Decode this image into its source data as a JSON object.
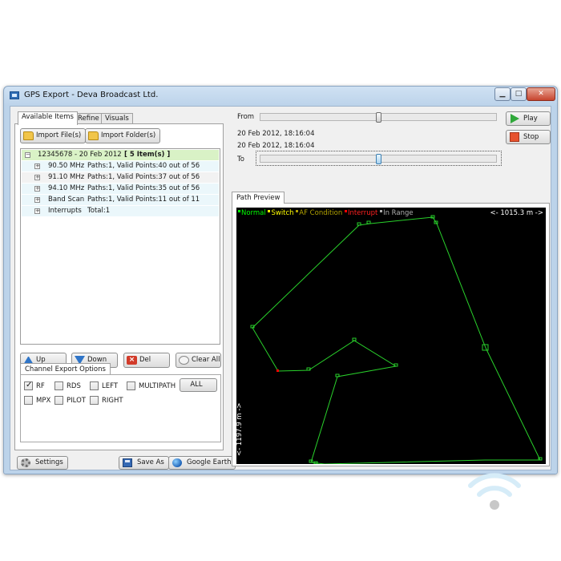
{
  "window": {
    "title": "GPS Export - Deva Broadcast Ltd."
  },
  "colors": {
    "normal": "#00ff00",
    "switch": "#ffff00",
    "af_condition": "#b0a000",
    "interrupt": "#ff0000",
    "in_range": "#b0b0b0",
    "path": "#29d12b"
  },
  "left_tabs": [
    "Available Items",
    "Refine",
    "Visuals"
  ],
  "import": {
    "files_label": "Import File(s)",
    "folder_label": "Import Folder(s)"
  },
  "tree": {
    "root": {
      "id": "12345678 - 20 Feb 2012",
      "count": "[ 5 Item(s) ]"
    },
    "items": [
      {
        "freq": "90.50 MHz",
        "info": "Paths:1, Valid Points:40 out of 56"
      },
      {
        "freq": "91.10 MHz",
        "info": "Paths:1, Valid Points:37 out of 56"
      },
      {
        "freq": "94.10 MHz",
        "info": "Paths:1, Valid Points:35 out of 56"
      },
      {
        "freq": "Band Scan",
        "info": "Paths:1, Valid Points:11 out of 11"
      },
      {
        "freq": "Interrupts",
        "info": "Total:1"
      }
    ]
  },
  "list_buttons": {
    "up": "Up",
    "down": "Down",
    "del": "Del",
    "clear_all": "Clear All"
  },
  "channel_export": {
    "tab": "Channel Export Options",
    "options": [
      {
        "label": "RF",
        "checked": true
      },
      {
        "label": "RDS",
        "checked": false
      },
      {
        "label": "LEFT",
        "checked": false
      },
      {
        "label": "MULTIPATH",
        "checked": false
      },
      {
        "label": "MPX",
        "checked": false
      },
      {
        "label": "PILOT",
        "checked": false
      },
      {
        "label": "RIGHT",
        "checked": false
      }
    ],
    "all_label": "ALL"
  },
  "bottom": {
    "settings": "Settings",
    "save_as": "Save As",
    "google_earth": "Google Earth"
  },
  "range": {
    "from_label": "From",
    "to_label": "To",
    "time_from": "20 Feb 2012, 18:16:04",
    "time_to": "20 Feb 2012, 18:16:04",
    "from_position": 0.5,
    "to_position": 0.5
  },
  "controls": {
    "play": "Play",
    "stop": "Stop"
  },
  "preview": {
    "tab": "Path Preview",
    "legend": {
      "normal": "Normal",
      "switch": "Switch",
      "af_condition": "AF Condition",
      "interrupt": "Interrupt",
      "in_range": "In Range"
    },
    "scale_h": "<- 1015.3 m ->",
    "scale_v": "<- 1197.9 m ->"
  }
}
